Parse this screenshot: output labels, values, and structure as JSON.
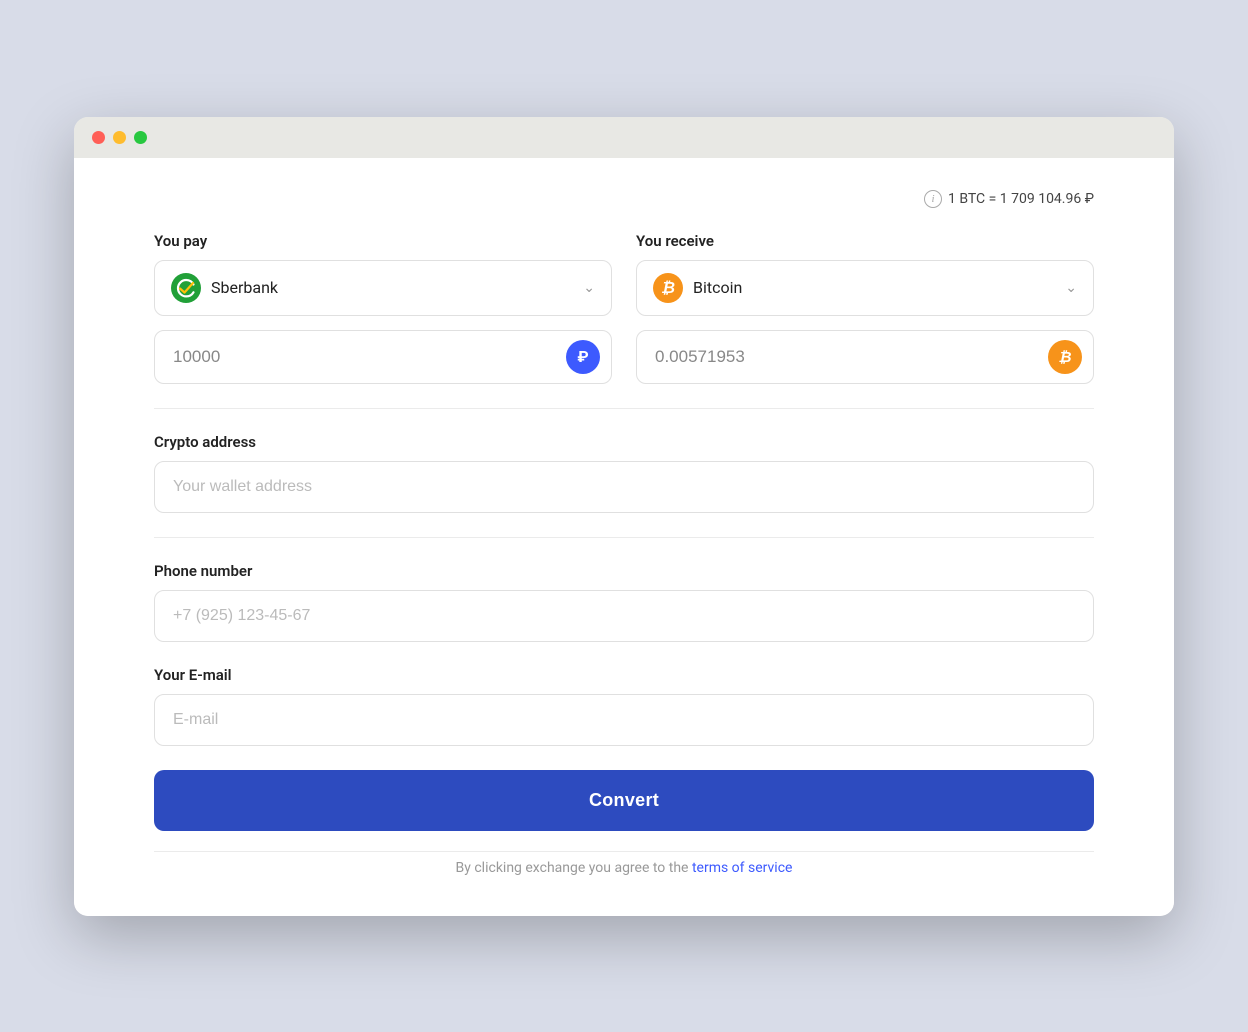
{
  "window": {
    "traffic_lights": {
      "red": "red",
      "yellow": "yellow",
      "green": "green"
    }
  },
  "rate_bar": {
    "info_icon_label": "i",
    "rate_text": "1 BTC  =  1 709 104.96 ₽"
  },
  "you_pay": {
    "label": "You pay",
    "bank_name": "Sberbank",
    "amount_value": "10000",
    "currency_symbol": "₽"
  },
  "you_receive": {
    "label": "You receive",
    "crypto_name": "Bitcoin",
    "amount_value": "0.00571953",
    "currency_symbol": "₿"
  },
  "crypto_address": {
    "label": "Crypto address",
    "placeholder": "Your wallet address"
  },
  "phone_number": {
    "label": "Phone number",
    "placeholder": "+7 (925) 123-45-67"
  },
  "email": {
    "label": "Your E-mail",
    "placeholder": "E-mail"
  },
  "convert_button": {
    "label": "Convert"
  },
  "footer": {
    "text": "By clicking exchange you agree to the ",
    "link_text": "terms of service"
  }
}
